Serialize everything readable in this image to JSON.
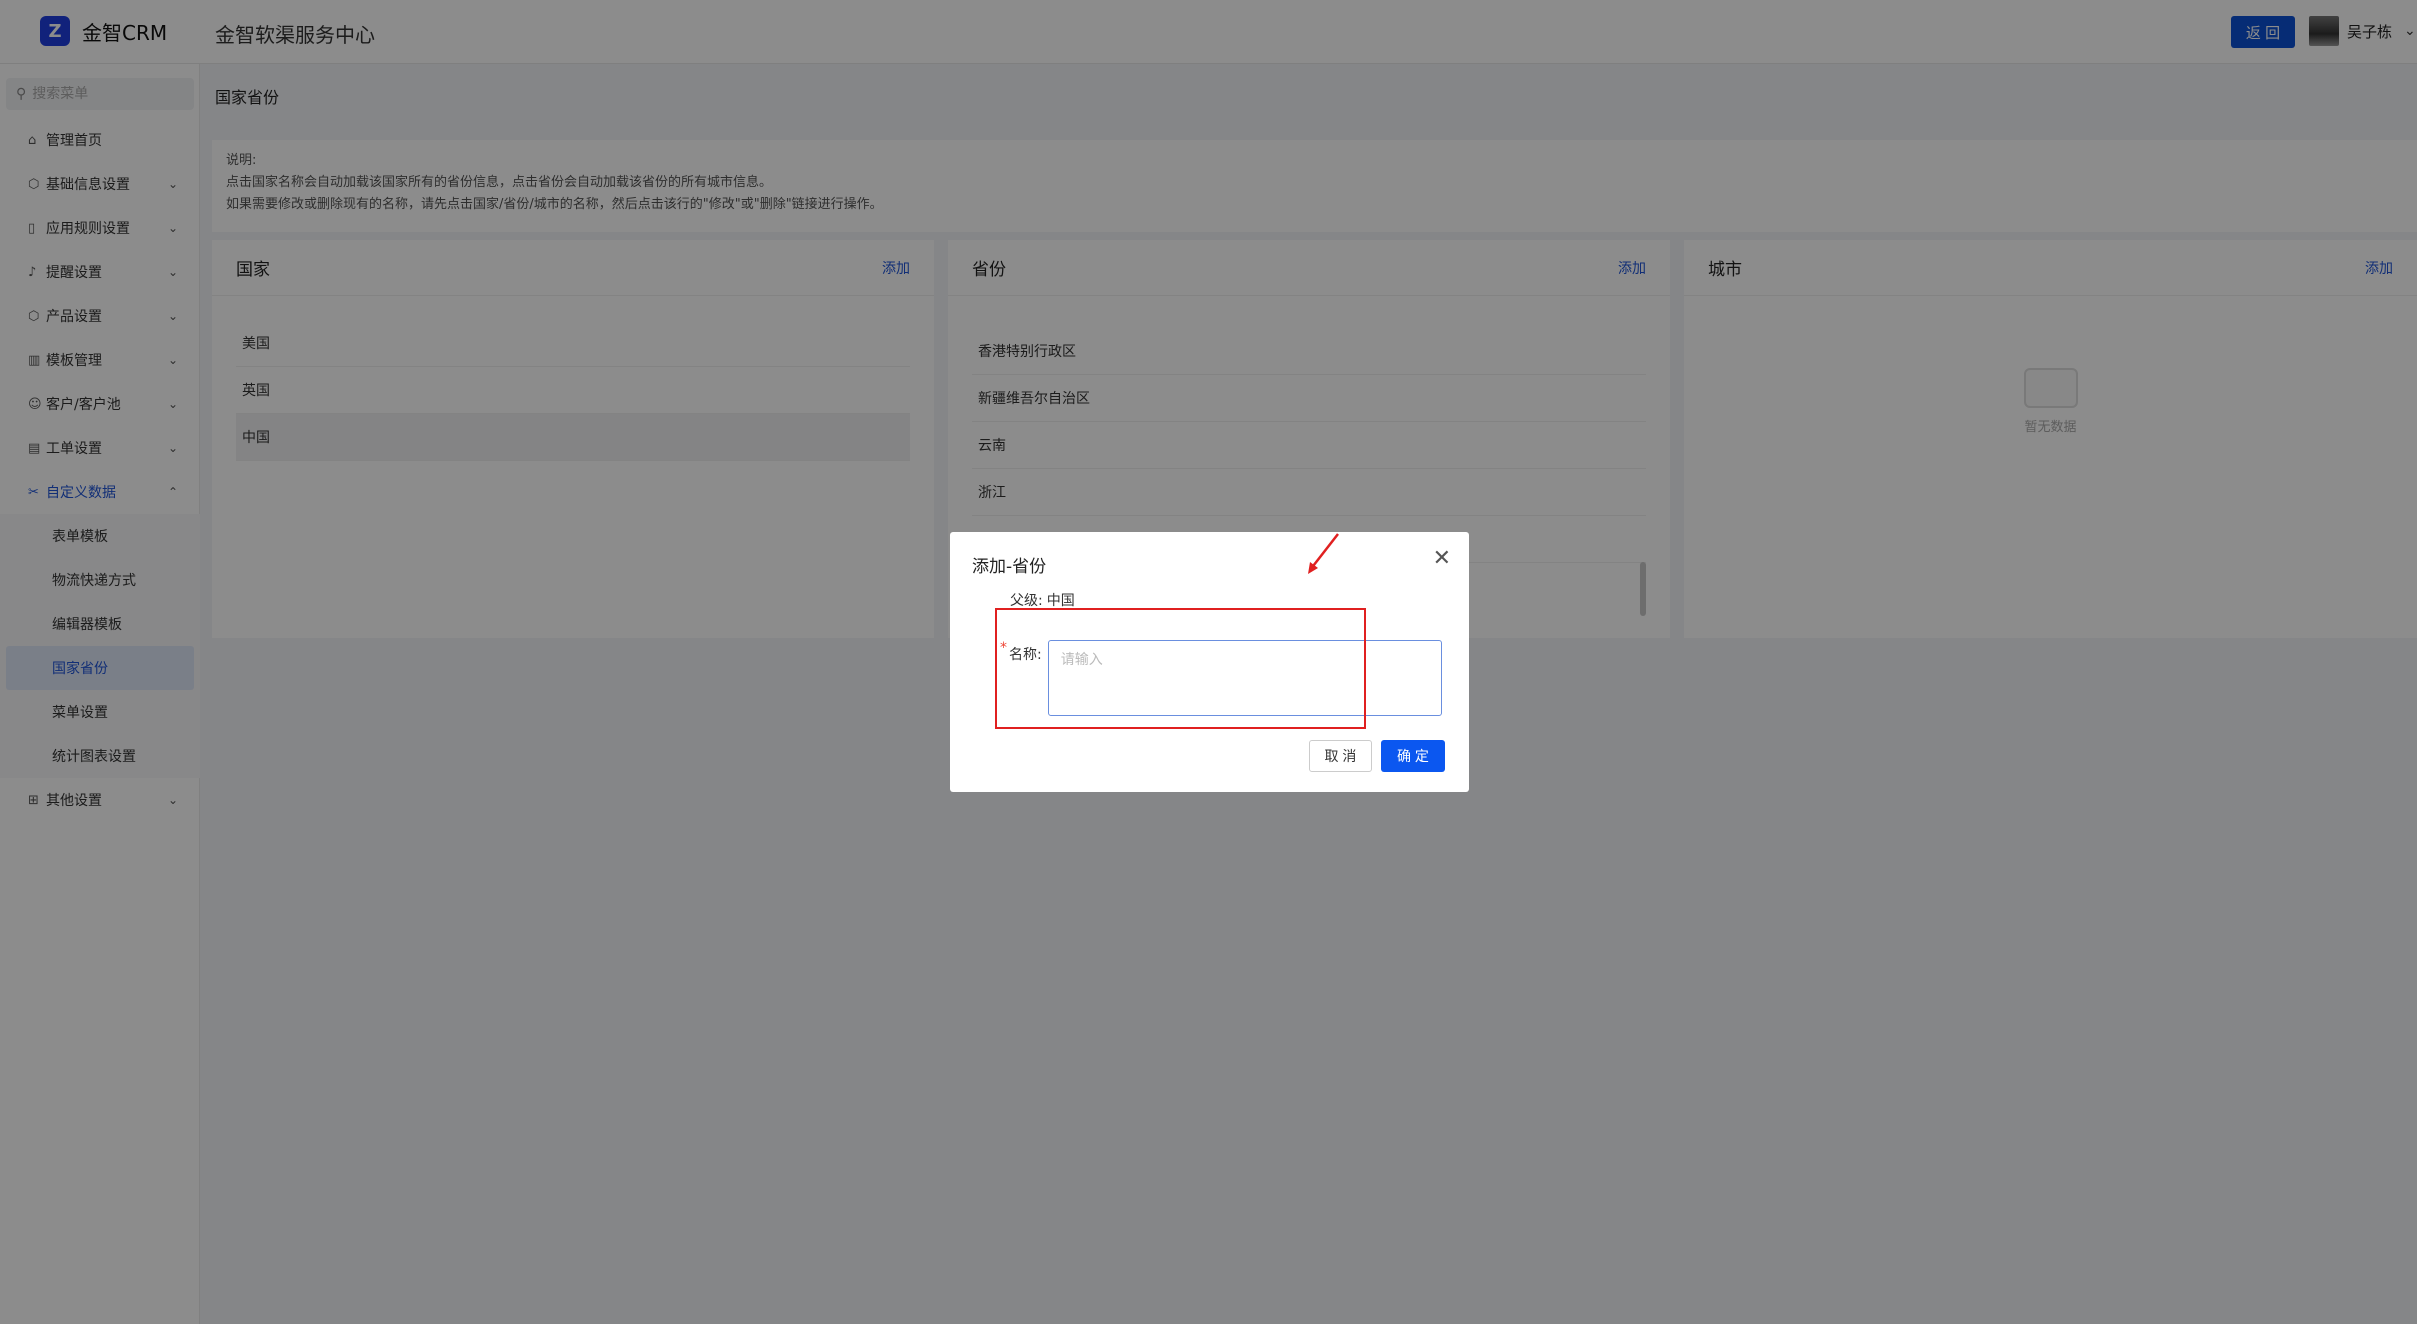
{
  "header": {
    "logo_text": "金智CRM",
    "title": "金智软渠服务中心",
    "back_label": "返 回",
    "user_name": "吴子栋"
  },
  "sidebar": {
    "search_placeholder": "搜索菜单",
    "items": [
      {
        "label": "管理首页",
        "icon": "home-icon"
      },
      {
        "label": "基础信息设置",
        "icon": "cube-icon"
      },
      {
        "label": "应用规则设置",
        "icon": "file-icon"
      },
      {
        "label": "提醒设置",
        "icon": "bell-icon"
      },
      {
        "label": "产品设置",
        "icon": "box-icon"
      },
      {
        "label": "模板管理",
        "icon": "template-icon"
      },
      {
        "label": "客户/客户池",
        "icon": "users-icon"
      },
      {
        "label": "工单设置",
        "icon": "ticket-icon"
      },
      {
        "label": "自定义数据",
        "icon": "tools-icon"
      }
    ],
    "subitems": [
      {
        "label": "表单模板"
      },
      {
        "label": "物流快递方式"
      },
      {
        "label": "编辑器模板"
      },
      {
        "label": "国家省份"
      },
      {
        "label": "菜单设置"
      },
      {
        "label": "统计图表设置"
      }
    ],
    "last_item": {
      "label": "其他设置",
      "icon": "grid-icon"
    }
  },
  "main": {
    "page_title": "国家省份",
    "notice": {
      "line1": "说明:",
      "line2": "点击国家名称会自动加载该国家所有的省份信息，点击省份会自动加载该省份的所有城市信息。",
      "line3": "如果需要修改或删除现有的名称，请先点击国家/省份/城市的名称，然后点击该行的\"修改\"或\"删除\"链接进行操作。"
    },
    "country_panel": {
      "title": "国家",
      "add": "添加",
      "rows": [
        "美国",
        "英国",
        "中国"
      ]
    },
    "province_panel": {
      "title": "省份",
      "add": "添加",
      "rows": [
        "香港特别行政区",
        "新疆维吾尔自治区",
        "云南",
        "浙江"
      ]
    },
    "city_panel": {
      "title": "城市",
      "add": "添加",
      "empty": "暂无数据"
    }
  },
  "modal": {
    "title": "添加-省份",
    "parent_label": "父级:",
    "parent_value": "中国",
    "name_label": "名称:",
    "name_placeholder": "请输入",
    "cancel_label": "取 消",
    "ok_label": "确 定"
  }
}
